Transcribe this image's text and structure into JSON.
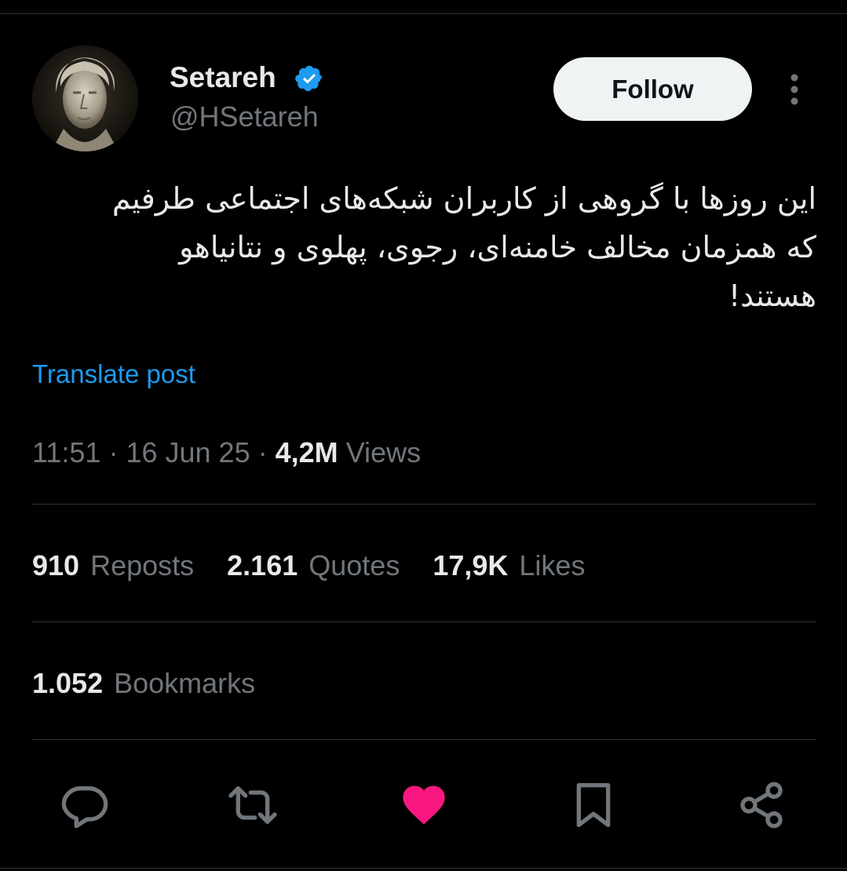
{
  "author": {
    "display_name": "Setareh",
    "handle": "@HSetareh",
    "verified_icon": "verified-badge-icon",
    "avatar": "avatar-icon"
  },
  "follow_label": "Follow",
  "tweet": {
    "lines": [
      "این روزها با گروهی از کاربران شبکه‌های اجتماعی طرفیم",
      "که همزمان مخالف خامنه‌ای، رجوی، پهلوی و نتانیاهو",
      "هستند!"
    ],
    "translate_label": "Translate post"
  },
  "meta": {
    "time": "11:51",
    "date": "16 Jun 25",
    "views_count": "4,2M",
    "views_label": "Views",
    "separator": "·"
  },
  "stats": {
    "reposts": {
      "count": "910",
      "label": "Reposts"
    },
    "quotes": {
      "count": "2.161",
      "label": "Quotes"
    },
    "likes": {
      "count": "17,9K",
      "label": "Likes"
    },
    "bookmarks": {
      "count": "1.052",
      "label": "Bookmarks"
    }
  },
  "actions": [
    "reply-icon",
    "repost-icon",
    "like-icon",
    "bookmark-icon",
    "share-icon"
  ],
  "colors": {
    "background": "#000000",
    "text_primary": "#e7e9ea",
    "text_secondary": "#71767b",
    "link": "#1d9bf0",
    "verified": "#1d9bf0",
    "like": "#f91880",
    "divider": "#2f3336"
  }
}
